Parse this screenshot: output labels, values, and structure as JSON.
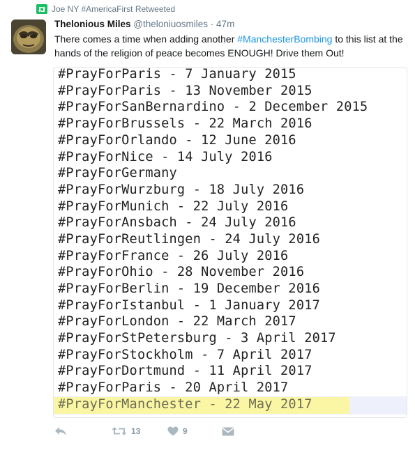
{
  "retweet_note": {
    "icon": "retweet-icon",
    "text": "Joe NY #AmericaFirst Retweeted"
  },
  "author": {
    "name": "Thelonious Miles",
    "handle": "@theloniuosmiles",
    "separator": " · ",
    "time": "47m"
  },
  "tweet": {
    "text_before": "There comes a time when adding another ",
    "hashtag": "#ManchesterBombing",
    "text_after": " to this list at the hands of the religion of peace becomes ENOUGH! Drive them Out!"
  },
  "image_list": [
    "#PrayForParis - 7 January 2015",
    "#PrayForParis - 13 November 2015",
    "#PrayForSanBernardino - 2 December 2015",
    "#PrayForBrussels - 22 March 2016",
    "#PrayForOrlando - 12 June 2016",
    "#PrayForNice - 14 July 2016",
    "#PrayForGermany",
    "#PrayForWurzburg - 18 July 2016",
    "#PrayForMunich - 22 July 2016",
    "#PrayForAnsbach - 24 July 2016",
    "#PrayForReutlingen - 24 July 2016",
    "#PrayForFrance - 26 July 2016",
    "#PrayForOhio - 28 November 2016",
    "#PrayForBerlin - 19 December 2016",
    "#PrayForIstanbul - 1 January 2017",
    "#PrayForLondon - 22 March 2017",
    "#PrayForStPetersburg - 3 April 2017",
    "#PrayForStockholm - 7 April 2017",
    "#PrayForDortmund - 11 April 2017",
    "#PrayForParis - 20 April 2017",
    "#PrayForManchester - 22 May 2017"
  ],
  "actions": {
    "reply_icon": "reply-icon",
    "retweet_icon": "retweet-icon",
    "retweet_count": "13",
    "like_icon": "heart-icon",
    "like_count": "9",
    "dm_icon": "envelope-icon"
  },
  "colors": {
    "link": "#1b95e0",
    "retweet_green": "#17bf63",
    "muted": "#657786",
    "highlight": "#fbf6a3"
  }
}
